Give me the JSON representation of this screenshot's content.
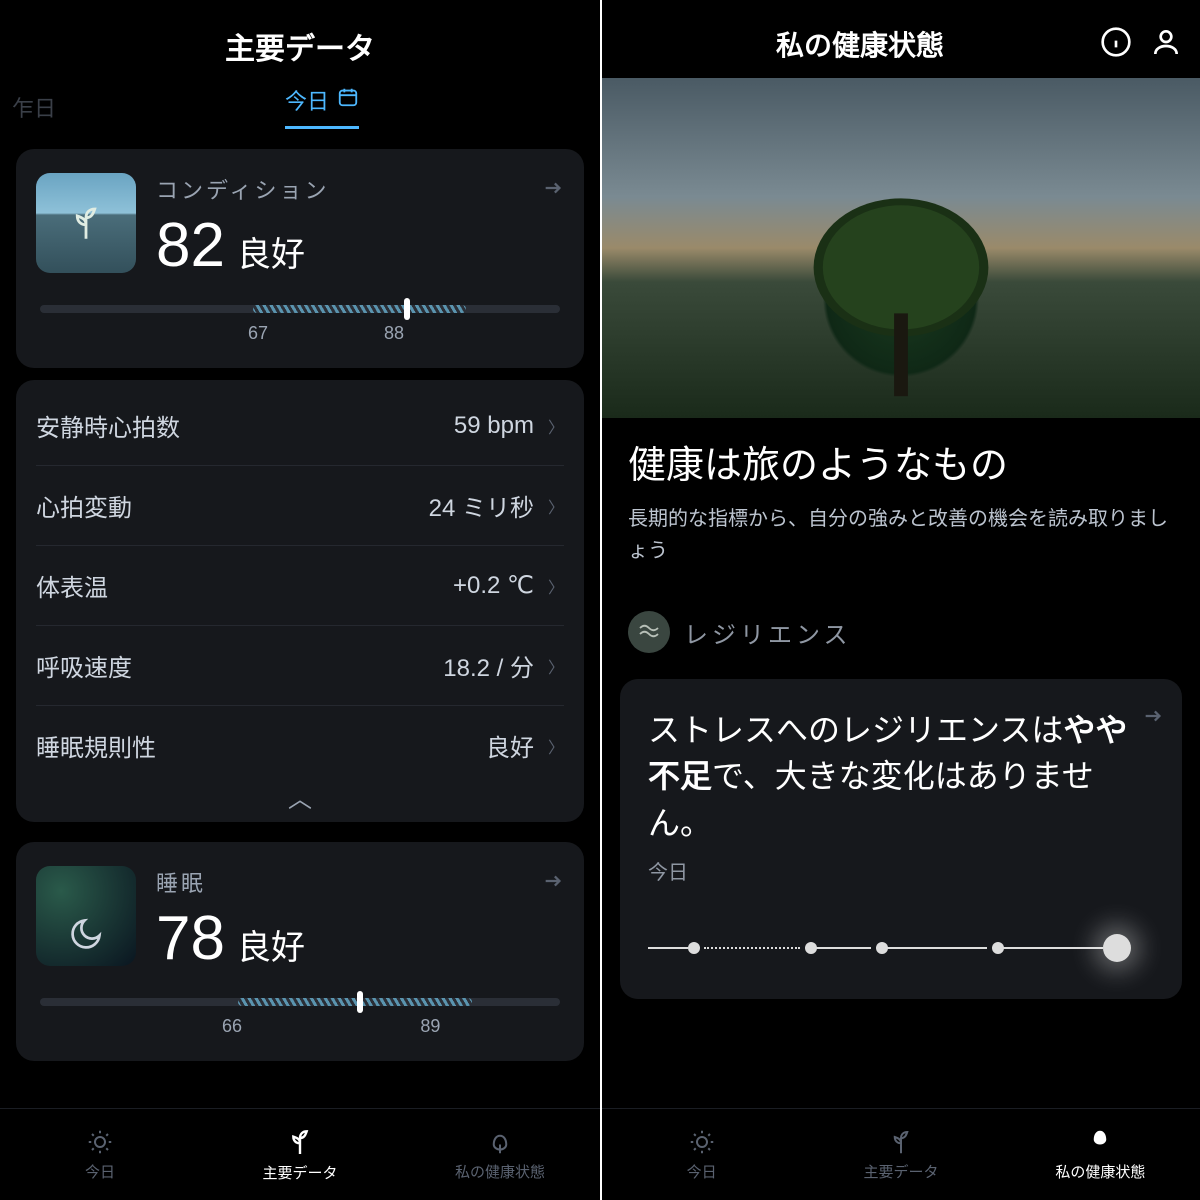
{
  "left": {
    "header": "主要データ",
    "top_tabs": {
      "yesterday": "乍日",
      "today": "今日"
    },
    "condition": {
      "title": "コンディション",
      "score": "82",
      "status": "良好",
      "range_low": "67",
      "range_high": "88"
    },
    "metrics": [
      {
        "label": "安静時心拍数",
        "value": "59 bpm"
      },
      {
        "label": "心拍変動",
        "value": "24 ミリ秒"
      },
      {
        "label": "体表温",
        "value": "+0.2 ℃"
      },
      {
        "label": "呼吸速度",
        "value": "18.2 / 分"
      },
      {
        "label": "睡眠規則性",
        "value": "良好"
      }
    ],
    "sleep": {
      "title": "睡眠",
      "score": "78",
      "status": "良好",
      "range_low": "66",
      "range_high": "89"
    },
    "nav": {
      "today": "今日",
      "vitals": "主要データ",
      "health": "私の健康状態"
    }
  },
  "right": {
    "header": "私の健康状態",
    "journey": {
      "title": "健康は旅のようなもの",
      "sub": "長期的な指標から、自分の強みと改善の機会を読み取りましょう"
    },
    "resilience": {
      "section": "レジリエンス",
      "text_pre": "ストレスへのレジリエンスは",
      "text_bold": "やや不足",
      "text_post": "で、大きな変化はありません。",
      "today": "今日"
    },
    "nav": {
      "today": "今日",
      "vitals": "主要データ",
      "health": "私の健康状態"
    }
  }
}
